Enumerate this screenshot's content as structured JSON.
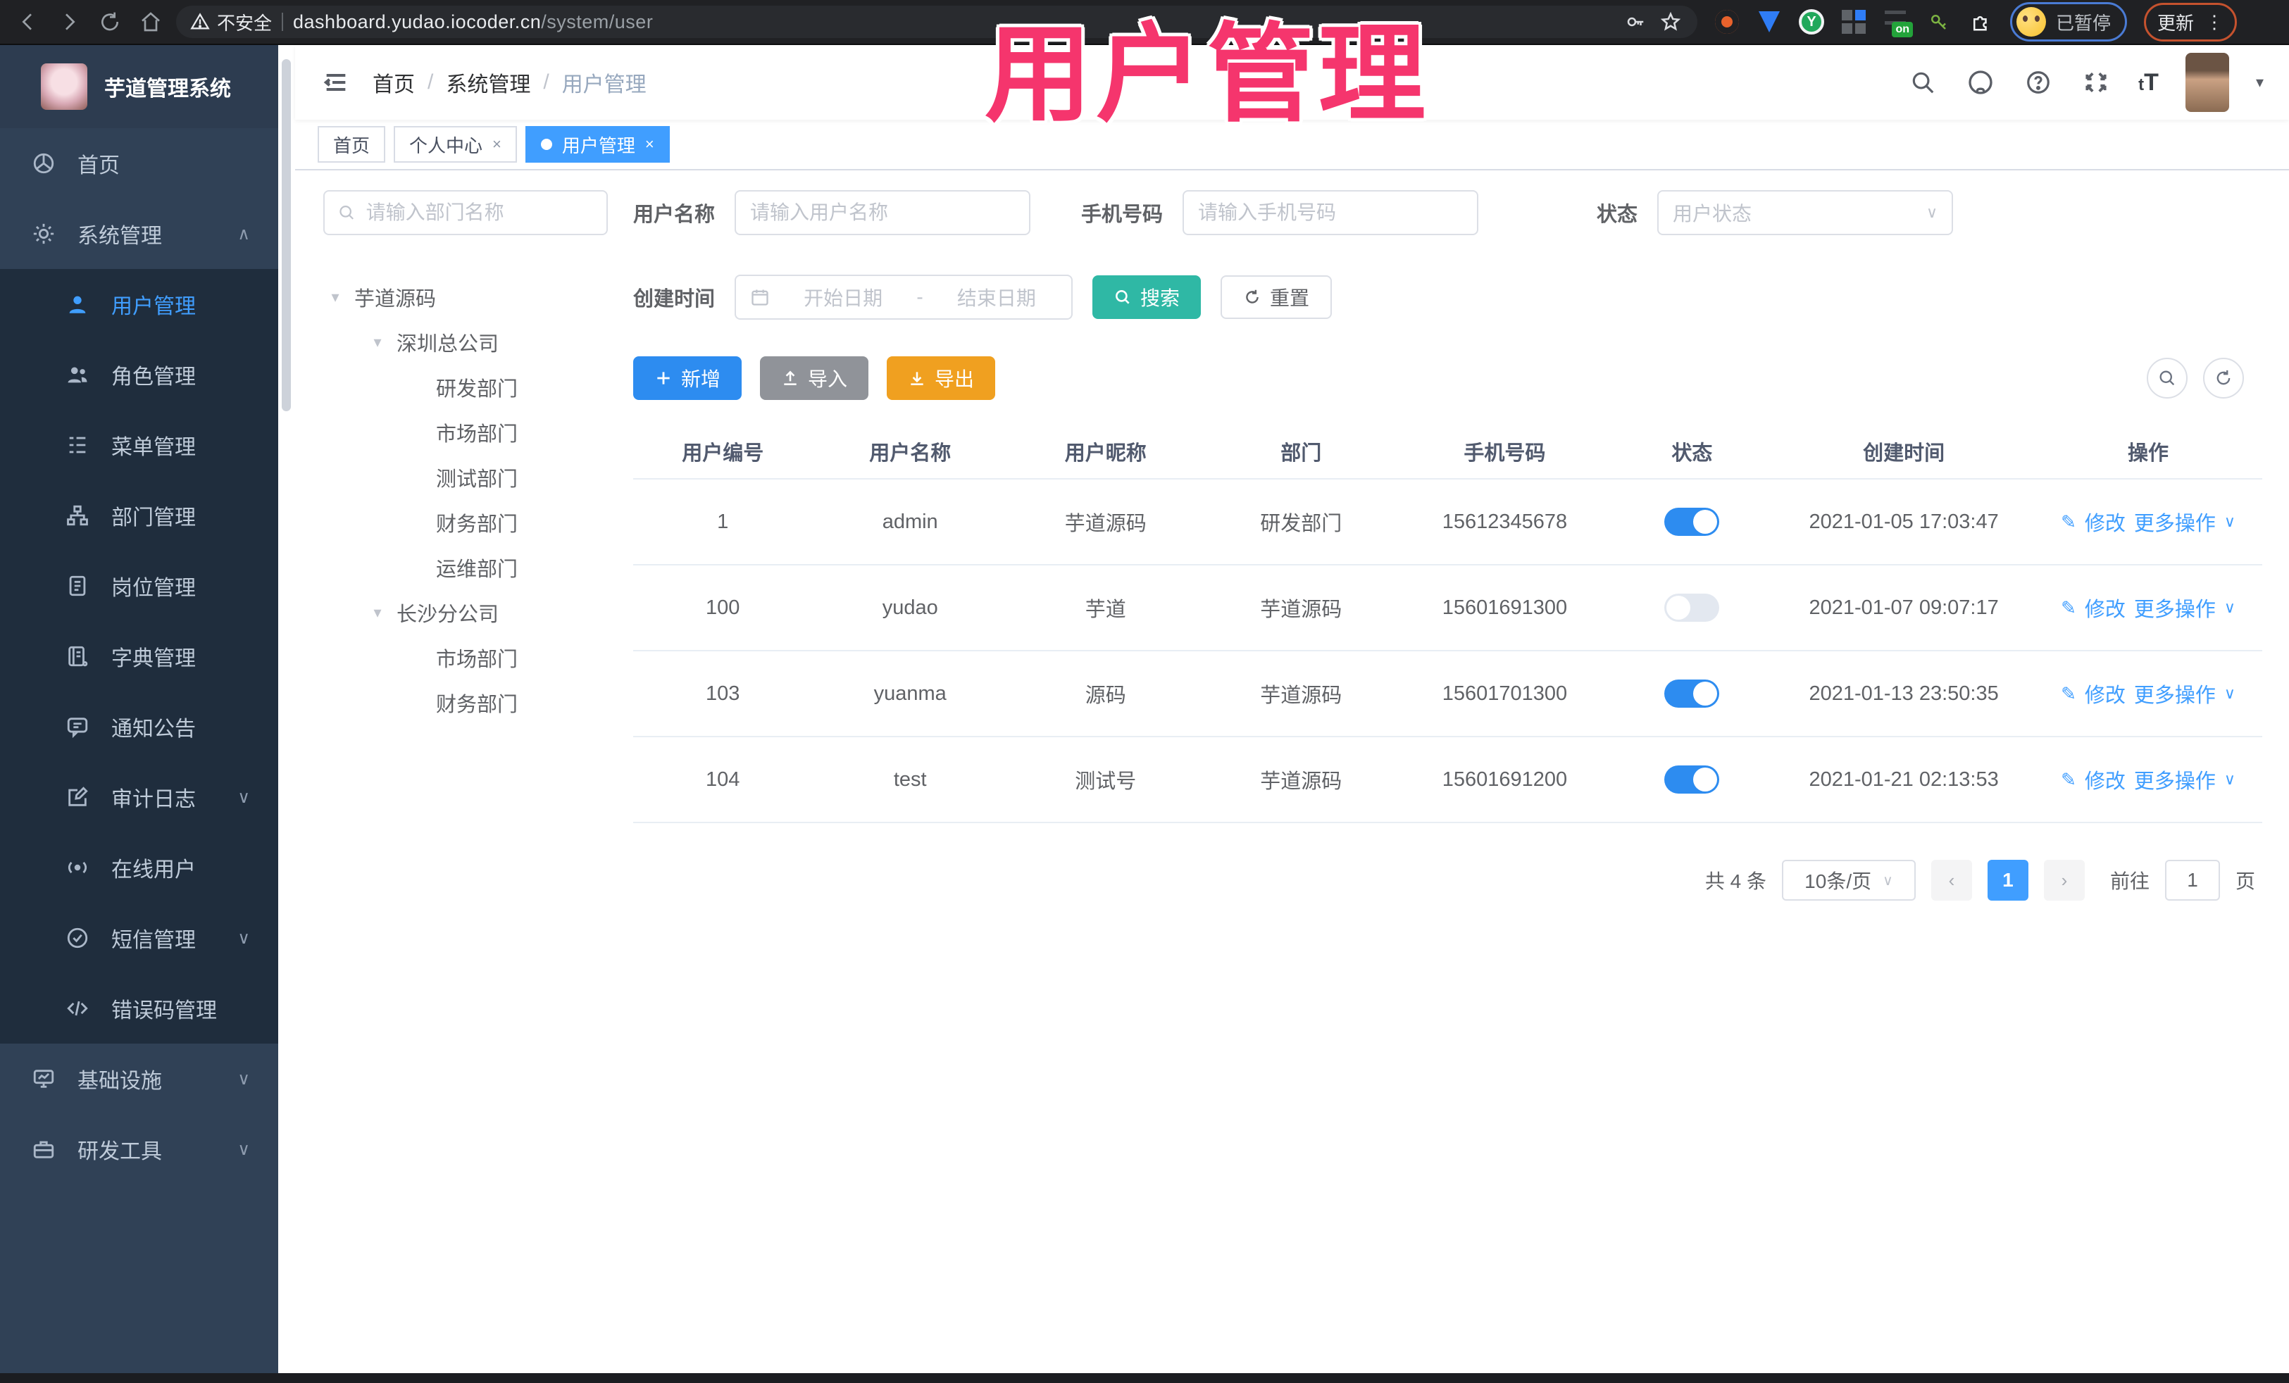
{
  "browser": {
    "security_label": "不安全",
    "url_host": "dashboard.yudao.iocoder.cn",
    "url_path": "/system/user",
    "paused_label": "已暂停",
    "update_label": "更新",
    "on_badge": "on",
    "green_ext_letter": "Y"
  },
  "overlay": {
    "title": "用户管理",
    "color": "#f5356d"
  },
  "sidebar": {
    "app_title": "芋道管理系统",
    "items": [
      {
        "label": "首页"
      },
      {
        "label": "系统管理"
      },
      {
        "label": "用户管理"
      },
      {
        "label": "角色管理"
      },
      {
        "label": "菜单管理"
      },
      {
        "label": "部门管理"
      },
      {
        "label": "岗位管理"
      },
      {
        "label": "字典管理"
      },
      {
        "label": "通知公告"
      },
      {
        "label": "审计日志"
      },
      {
        "label": "在线用户"
      },
      {
        "label": "短信管理"
      },
      {
        "label": "错误码管理"
      },
      {
        "label": "基础设施"
      },
      {
        "label": "研发工具"
      }
    ],
    "chevron_up": "∧",
    "chevron_down": "∨"
  },
  "header": {
    "breadcrumb": [
      "首页",
      "系统管理",
      "用户管理"
    ],
    "separator": "/",
    "font_size_icon": "tT"
  },
  "tabs": [
    {
      "label": "首页"
    },
    {
      "label": "个人中心",
      "close": "×"
    },
    {
      "label": "用户管理",
      "close": "×"
    }
  ],
  "dept_panel": {
    "search_placeholder": "请输入部门名称",
    "caret": "▾",
    "tree": [
      {
        "label": "芋道源码"
      },
      {
        "label": "深圳总公司"
      },
      {
        "label": "研发部门"
      },
      {
        "label": "市场部门"
      },
      {
        "label": "测试部门"
      },
      {
        "label": "财务部门"
      },
      {
        "label": "运维部门"
      },
      {
        "label": "长沙分公司"
      },
      {
        "label": "市场部门"
      },
      {
        "label": "财务部门"
      }
    ]
  },
  "filters": {
    "username_label": "用户名称",
    "username_placeholder": "请输入用户名称",
    "mobile_label": "手机号码",
    "mobile_placeholder": "请输入手机号码",
    "status_label": "状态",
    "status_placeholder": "用户状态",
    "create_time_label": "创建时间",
    "start_placeholder": "开始日期",
    "range_separator": "-",
    "end_placeholder": "结束日期",
    "search_label": "搜索",
    "reset_label": "重置"
  },
  "toolbar": {
    "add_label": "新增",
    "import_label": "导入",
    "export_label": "导出"
  },
  "table": {
    "columns": [
      "用户编号",
      "用户名称",
      "用户昵称",
      "部门",
      "手机号码",
      "状态",
      "创建时间",
      "操作"
    ],
    "actions": {
      "edit": "修改",
      "more": "更多操作"
    },
    "rows": [
      {
        "id": "1",
        "username": "admin",
        "nickname": "芋道源码",
        "dept": "研发部门",
        "mobile": "15612345678",
        "status": "on",
        "created": "2021-01-05 17:03:47"
      },
      {
        "id": "100",
        "username": "yudao",
        "nickname": "芋道",
        "dept": "芋道源码",
        "mobile": "15601691300",
        "status": "off",
        "created": "2021-01-07 09:07:17"
      },
      {
        "id": "103",
        "username": "yuanma",
        "nickname": "源码",
        "dept": "芋道源码",
        "mobile": "15601701300",
        "status": "on",
        "created": "2021-01-13 23:50:35"
      },
      {
        "id": "104",
        "username": "test",
        "nickname": "测试号",
        "dept": "芋道源码",
        "mobile": "15601691200",
        "status": "on",
        "created": "2021-01-21 02:13:53"
      }
    ]
  },
  "pagination": {
    "total_label": "共 4 条",
    "page_size_label": "10条/页",
    "prev": "‹",
    "next": "›",
    "current_page": "1",
    "goto_label": "前往",
    "page_unit_label": "页"
  }
}
